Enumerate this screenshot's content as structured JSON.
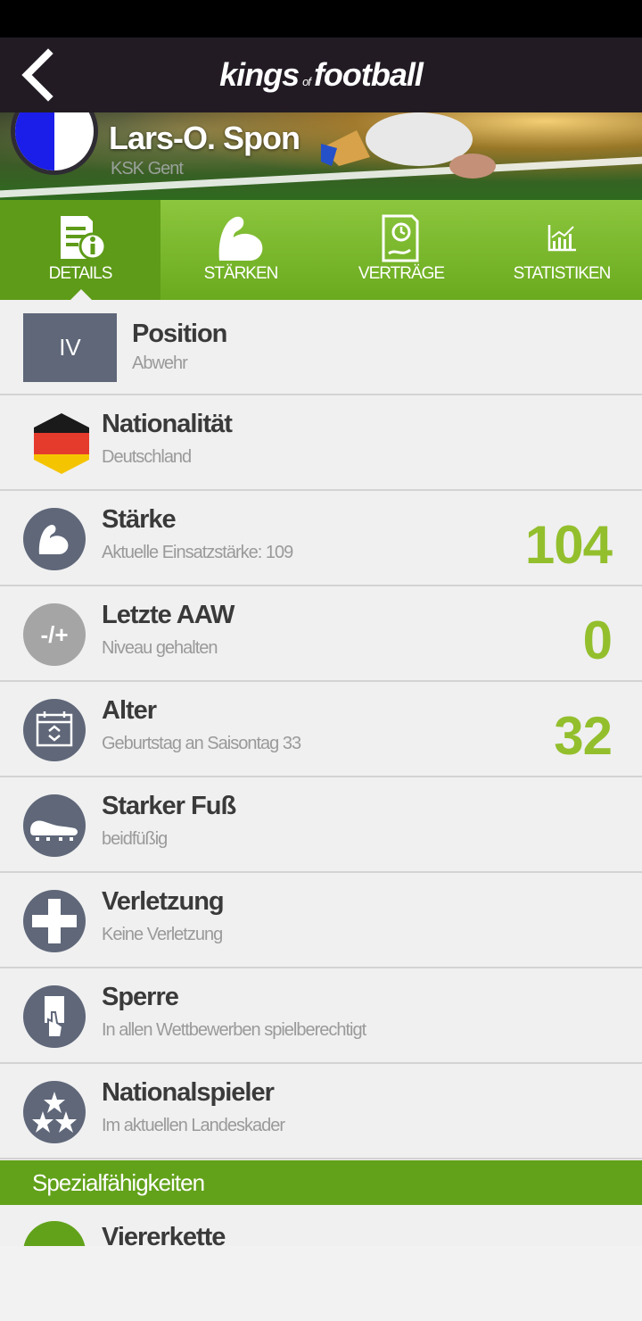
{
  "header": {
    "logo_kings": "kings",
    "logo_of": "of",
    "logo_football": "football",
    "back_icon": "chevron-left-icon"
  },
  "player": {
    "name": "Lars-O. Spon",
    "club": "KSK Gent"
  },
  "tabs": [
    {
      "label": "DETAILS",
      "icon": "document-info-icon",
      "active": true
    },
    {
      "label": "STÄRKEN",
      "icon": "flexed-arm-icon",
      "active": false
    },
    {
      "label": "VERTRÄGE",
      "icon": "contract-icon",
      "active": false
    },
    {
      "label": "STATISTIKEN",
      "icon": "chart-icon",
      "active": false
    }
  ],
  "rows": {
    "position": {
      "badge": "IV",
      "title": "Position",
      "sub": "Abwehr"
    },
    "nationality": {
      "title": "Nationalität",
      "sub": "Deutschland",
      "icon": "germany-flag-icon"
    },
    "strength": {
      "title": "Stärke",
      "sub": "Aktuelle Einsatzstärke: 109",
      "value": "104",
      "icon": "flexed-arm-icon"
    },
    "aaw": {
      "title": "Letzte AAW",
      "sub": "Niveau gehalten",
      "value": "0",
      "icon_text": "-/+"
    },
    "age": {
      "title": "Alter",
      "sub": "Geburtstag an Saisontag 33",
      "value": "32",
      "icon": "calendar-icon"
    },
    "foot": {
      "title": "Starker Fuß",
      "sub": "beidfüßig",
      "icon": "football-boot-icon"
    },
    "injury": {
      "title": "Verletzung",
      "sub": "Keine Verletzung",
      "icon": "medical-cross-icon"
    },
    "suspension": {
      "title": "Sperre",
      "sub": "In allen Wettbewerben spielberechtigt",
      "icon": "referee-card-icon"
    },
    "national": {
      "title": "Nationalspieler",
      "sub": "Im aktuellen Landeskader",
      "icon": "stars-icon"
    }
  },
  "special": {
    "header": "Spezialfähigkeiten",
    "first_item": "Viererkette"
  },
  "colors": {
    "accent_green": "#93bf2d",
    "tab_green": "#6aaa1e",
    "header_dark": "#221b24",
    "icon_slate": "#5f6779"
  }
}
